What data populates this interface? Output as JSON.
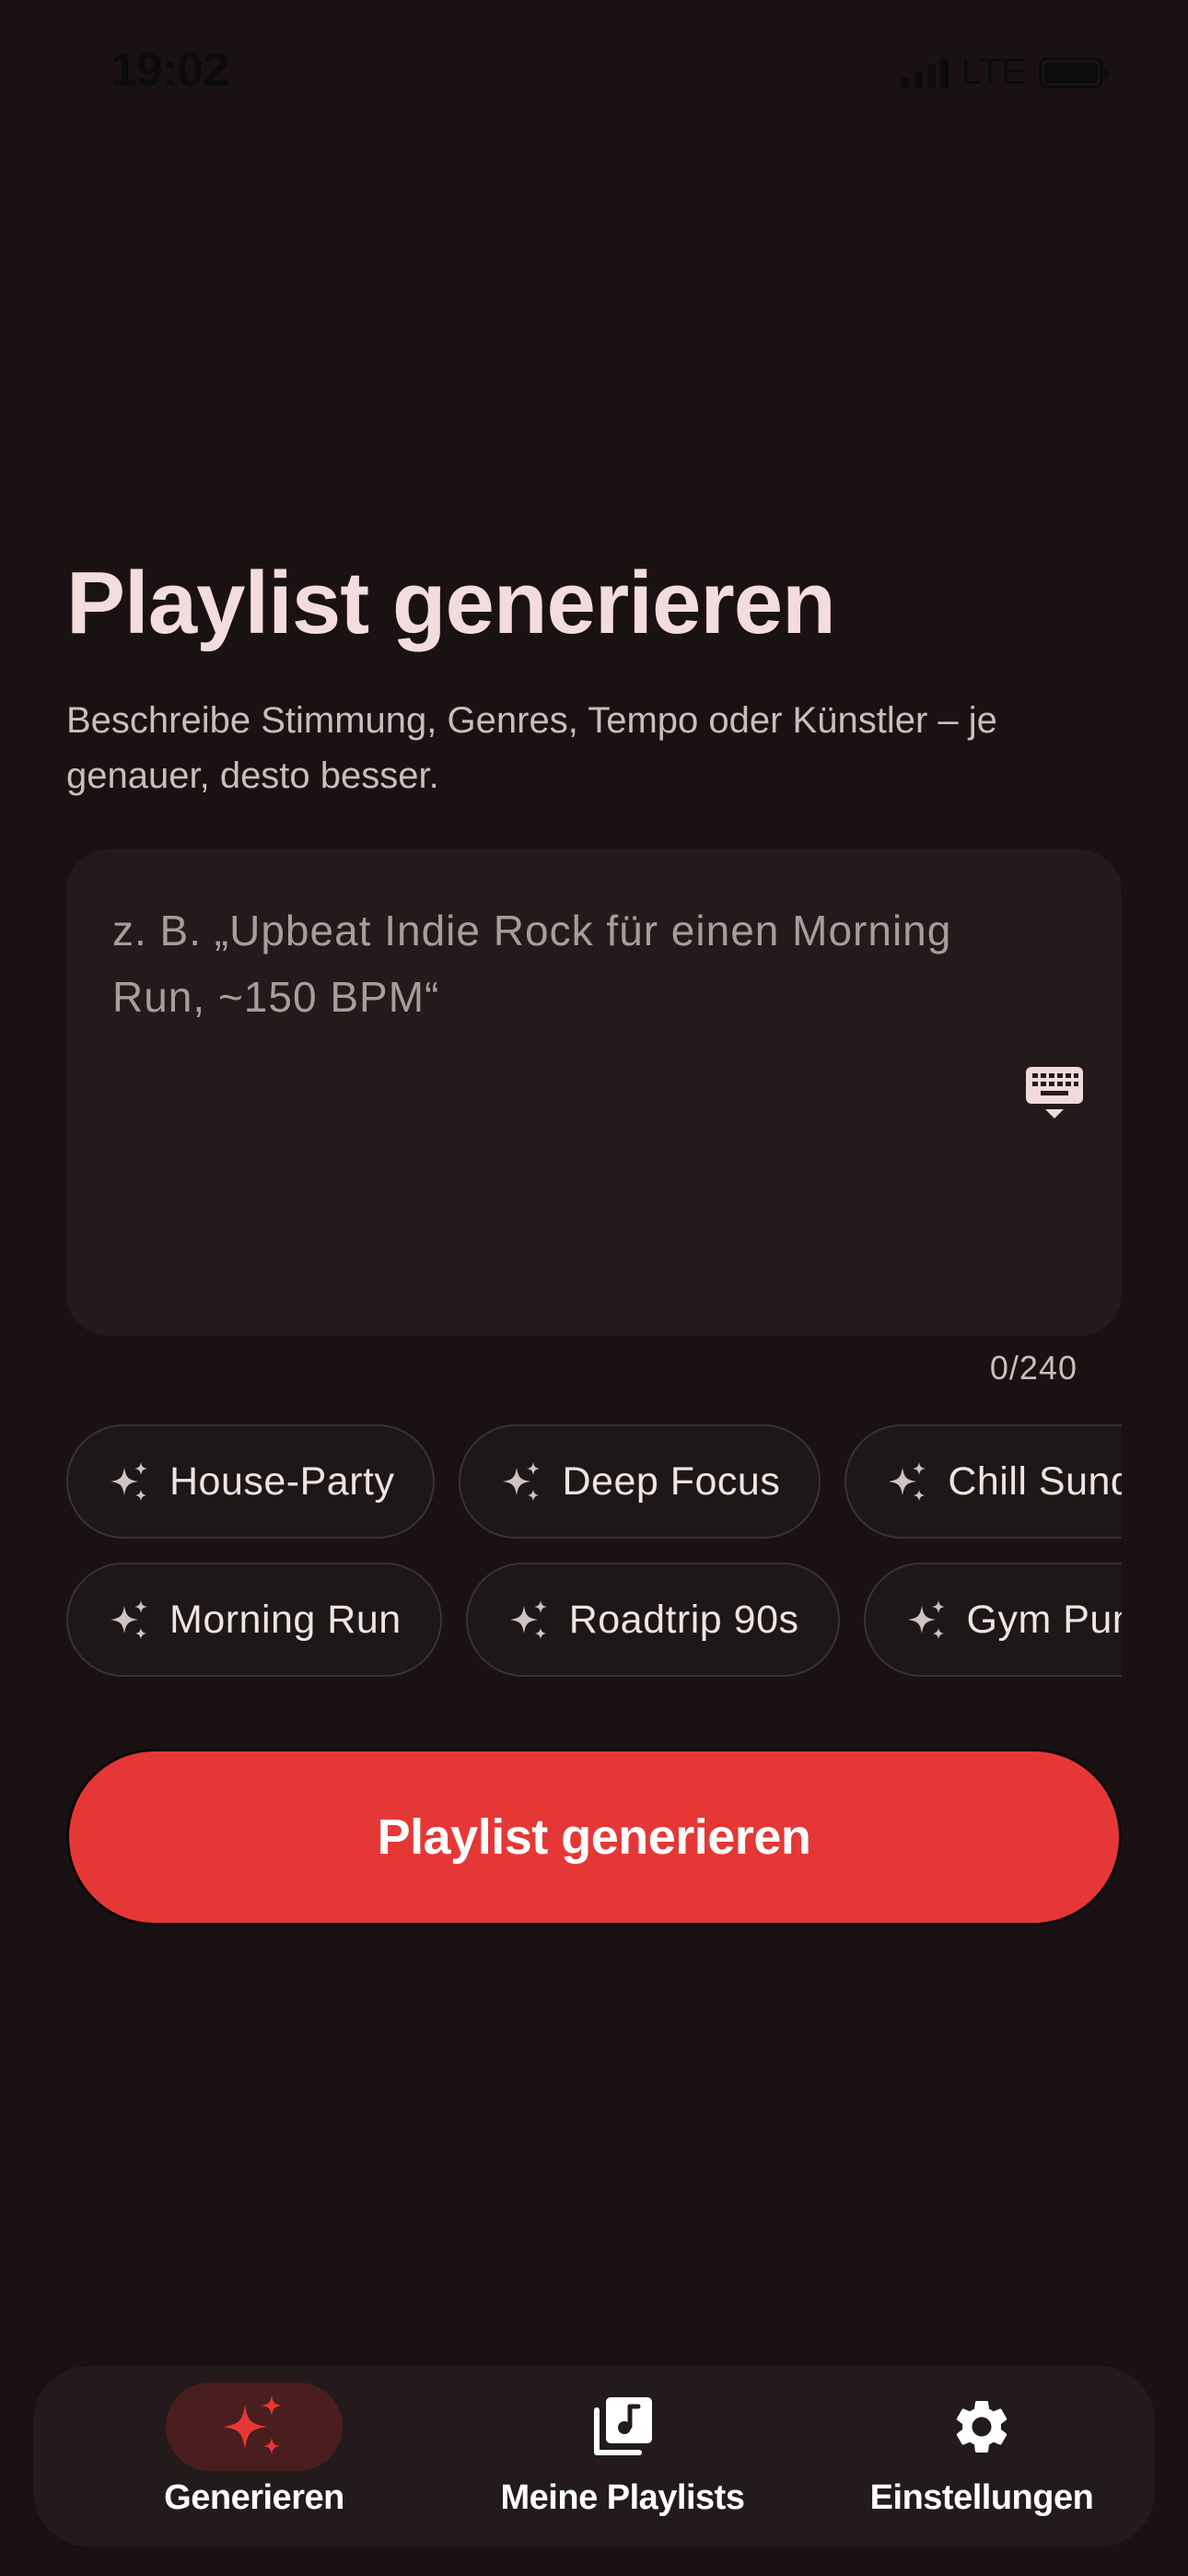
{
  "status": {
    "time": "19:02",
    "network": "LTE"
  },
  "header": {
    "title": "Playlist generieren",
    "subtitle": "Beschreibe Stimmung, Genres, Tempo oder Künstler – je genauer, desto besser."
  },
  "prompt": {
    "placeholder": "z. B. „Upbeat Indie Rock für einen Morning Run, ~150 BPM“",
    "value": "",
    "counter": "0/240"
  },
  "suggestions": {
    "row1": [
      "House-Party",
      "Deep Focus",
      "Chill Sunday"
    ],
    "row2": [
      "Morning Run",
      "Roadtrip 90s",
      "Gym Pump"
    ]
  },
  "generate_button": {
    "label": "Playlist generieren"
  },
  "bottom_nav": {
    "items": [
      {
        "label": "Generieren",
        "icon": "sparkle-icon",
        "active": true
      },
      {
        "label": "Meine Playlists",
        "icon": "music-library-icon",
        "active": false
      },
      {
        "label": "Einstellungen",
        "icon": "gear-icon",
        "active": false
      }
    ]
  },
  "colors": {
    "background": "#1a1212",
    "surface": "#231b1b",
    "accent": "#e53836",
    "title": "#f3dcdc"
  }
}
